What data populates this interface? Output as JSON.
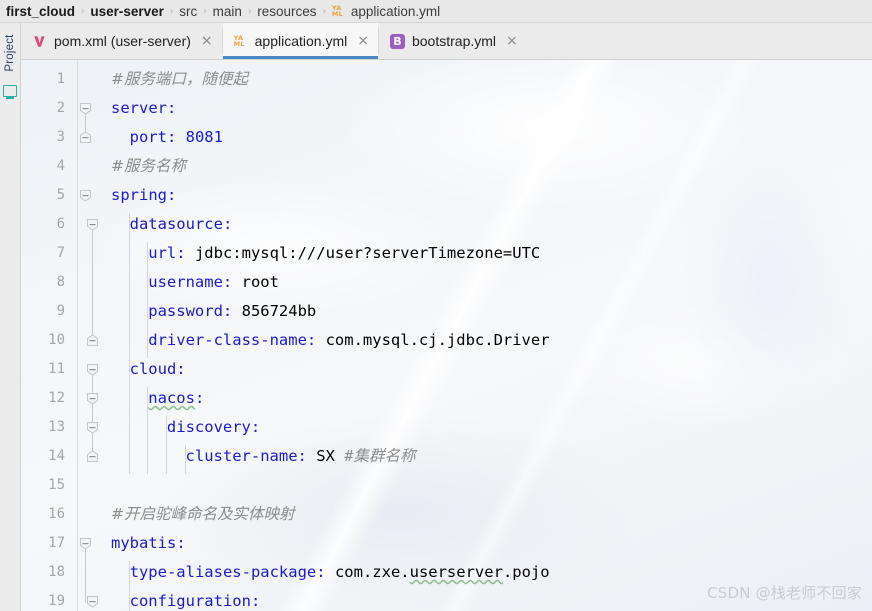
{
  "breadcrumb": {
    "separator": "›",
    "items": [
      {
        "label": "first_cloud",
        "bold": true,
        "icon": null
      },
      {
        "label": "user-server",
        "bold": true,
        "icon": null
      },
      {
        "label": "src",
        "bold": false,
        "icon": null
      },
      {
        "label": "main",
        "bold": false,
        "icon": null
      },
      {
        "label": "resources",
        "bold": false,
        "icon": null
      },
      {
        "label": "application.yml",
        "bold": false,
        "icon": "yaml-icon"
      }
    ]
  },
  "tool_window": {
    "project_label": "Project",
    "project_icon": "project-structure-icon"
  },
  "tabs": {
    "close_glyph": "×",
    "items": [
      {
        "label": "pom.xml (user-server)",
        "icon": "maven-icon",
        "active": false
      },
      {
        "label": "application.yml",
        "icon": "yaml-icon",
        "active": true
      },
      {
        "label": "bootstrap.yml",
        "icon": "bootstrap-icon",
        "active": false
      }
    ]
  },
  "editor": {
    "language": "yaml",
    "file": "application.yml",
    "colors": {
      "key": "#1a1aca",
      "value": "#000000",
      "comment": "#8c8c8c",
      "lineno": "#a6a6a6",
      "accent": "#4a88c7",
      "background": "#f7f8fa",
      "spellcheck_wave": "#8fbf8f"
    },
    "lines": [
      {
        "n": 1,
        "indent": 0,
        "text": "#服务端口，随便起"
      },
      {
        "n": 2,
        "indent": 0,
        "text": "server:"
      },
      {
        "n": 3,
        "indent": 1,
        "text": "port: 8081"
      },
      {
        "n": 4,
        "indent": 0,
        "text": "#服务名称"
      },
      {
        "n": 5,
        "indent": 0,
        "text": "spring:"
      },
      {
        "n": 6,
        "indent": 1,
        "text": "datasource:"
      },
      {
        "n": 7,
        "indent": 2,
        "text": "url: jdbc:mysql:///user?serverTimezone=UTC"
      },
      {
        "n": 8,
        "indent": 2,
        "text": "username: root"
      },
      {
        "n": 9,
        "indent": 2,
        "text": "password: 856724bb"
      },
      {
        "n": 10,
        "indent": 2,
        "text": "driver-class-name: com.mysql.cj.jdbc.Driver"
      },
      {
        "n": 11,
        "indent": 1,
        "text": "cloud:"
      },
      {
        "n": 12,
        "indent": 2,
        "text": "nacos:"
      },
      {
        "n": 13,
        "indent": 3,
        "text": "discovery:"
      },
      {
        "n": 14,
        "indent": 4,
        "text": "cluster-name: SX #集群名称"
      },
      {
        "n": 15,
        "indent": 0,
        "text": ""
      },
      {
        "n": 16,
        "indent": 0,
        "text": "#开启驼峰命名及实体映射"
      },
      {
        "n": 17,
        "indent": 0,
        "text": "mybatis:"
      },
      {
        "n": 18,
        "indent": 1,
        "text": "type-aliases-package: com.zxe.userserver.pojo"
      },
      {
        "n": 19,
        "indent": 1,
        "text": "configuration:"
      }
    ]
  },
  "watermark": {
    "text": "CSDN @栈老师不回家"
  }
}
